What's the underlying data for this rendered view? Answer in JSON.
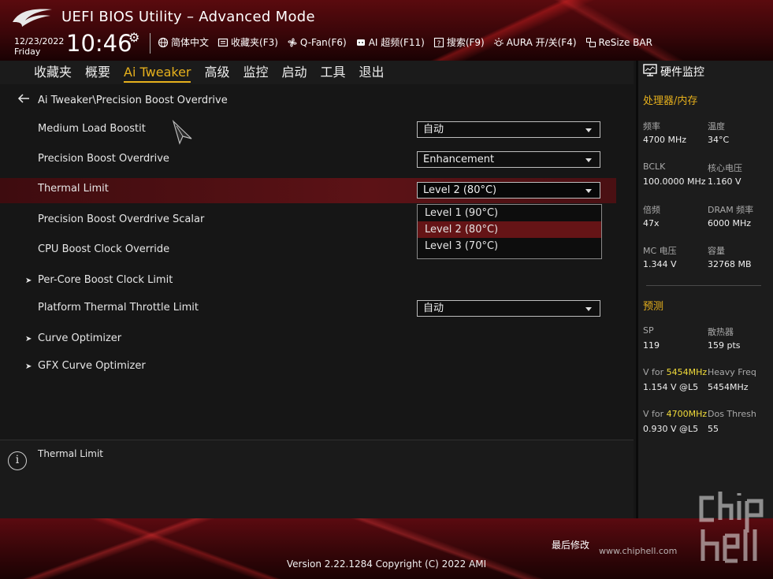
{
  "header": {
    "title": "UEFI BIOS Utility – Advanced Mode",
    "date": "12/23/2022",
    "day": "Friday",
    "time": "10:46",
    "tools": [
      {
        "icon": "globe-icon",
        "label": "简体中文"
      },
      {
        "icon": "bookmark-icon",
        "label": "收藏夹(F3)"
      },
      {
        "icon": "fan-icon",
        "label": "Q-Fan(F6)"
      },
      {
        "icon": "ai-overclock-icon",
        "label": "AI 超频(F11)"
      },
      {
        "icon": "search-help-icon",
        "label": "搜索(F9)"
      },
      {
        "icon": "aura-light-icon",
        "label": "AURA 开/关(F4)"
      },
      {
        "icon": "resize-bar-icon",
        "label": "ReSize BAR"
      }
    ]
  },
  "tabs": [
    {
      "label": "收藏夹",
      "active": false
    },
    {
      "label": "概要",
      "active": false
    },
    {
      "label": "Ai Tweaker",
      "active": true
    },
    {
      "label": "高级",
      "active": false
    },
    {
      "label": "监控",
      "active": false
    },
    {
      "label": "启动",
      "active": false
    },
    {
      "label": "工具",
      "active": false
    },
    {
      "label": "退出",
      "active": false
    }
  ],
  "breadcrumb": "Ai Tweaker\\Precision Boost Overdrive",
  "settings": {
    "medium_load_boostit": {
      "label": "Medium Load Boostit",
      "value": "自动"
    },
    "pbo": {
      "label": "Precision Boost Overdrive",
      "value": "Enhancement"
    },
    "thermal_limit": {
      "label": "Thermal Limit",
      "value": "Level 2 (80°C)"
    },
    "pbo_scalar": {
      "label": "Precision Boost Overdrive Scalar"
    },
    "cpu_boost_clock_override": {
      "label": "CPU Boost Clock Override"
    },
    "per_core_boost_clock_limit": {
      "label": "Per-Core Boost Clock Limit"
    },
    "platform_thermal_throttle": {
      "label": "Platform Thermal Throttle Limit",
      "value": "自动"
    },
    "curve_optimizer": {
      "label": "Curve Optimizer"
    },
    "gfx_curve_optimizer": {
      "label": "GFX Curve Optimizer"
    }
  },
  "dropdown_options": [
    "Level 1 (90°C)",
    "Level 2 (80°C)",
    "Level 3 (70°C)"
  ],
  "dropdown_selected_index": 1,
  "help_text": "Thermal Limit",
  "monitor": {
    "title": "硬件监控",
    "cpu_mem_title": "处理器/内存",
    "freq_label": "频率",
    "freq": "4700 MHz",
    "temp_label": "温度",
    "temp": "34°C",
    "bclk_label": "BCLK",
    "bclk": "100.0000 MHz",
    "core_v_label": "核心电压",
    "core_v": "1.160 V",
    "ratio_label": "倍频",
    "ratio": "47x",
    "dram_freq_label": "DRAM 频率",
    "dram_freq": "6000 MHz",
    "mc_v_label": "MC 电压",
    "mc_v": "1.344 V",
    "capacity_label": "容量",
    "capacity": "32768 MB",
    "predict_title": "预测",
    "sp_label": "SP",
    "sp": "119",
    "cooler_label": "散热器",
    "cooler": "159 pts",
    "vfor1_prefix": "V for ",
    "vfor1_freq": "5454MHz",
    "vfor1": "1.154 V @L5",
    "heavy_freq_label": "Heavy Freq",
    "heavy_freq": "5454MHz",
    "vfor2_prefix": "V for ",
    "vfor2_freq": "4700MHz",
    "vfor2": "0.930 V @L5",
    "dos_thresh_label": "Dos Thresh",
    "dos_thresh": "55"
  },
  "footer": {
    "last_modified": "最后修改",
    "version": "Version 2.22.1284 Copyright (C) 2022 AMI",
    "watermark_url": "www.chiphell.com"
  },
  "colors": {
    "accent": "#e6b01c",
    "highlight": "#5c1216",
    "brand_red": "#5a0a0e"
  }
}
